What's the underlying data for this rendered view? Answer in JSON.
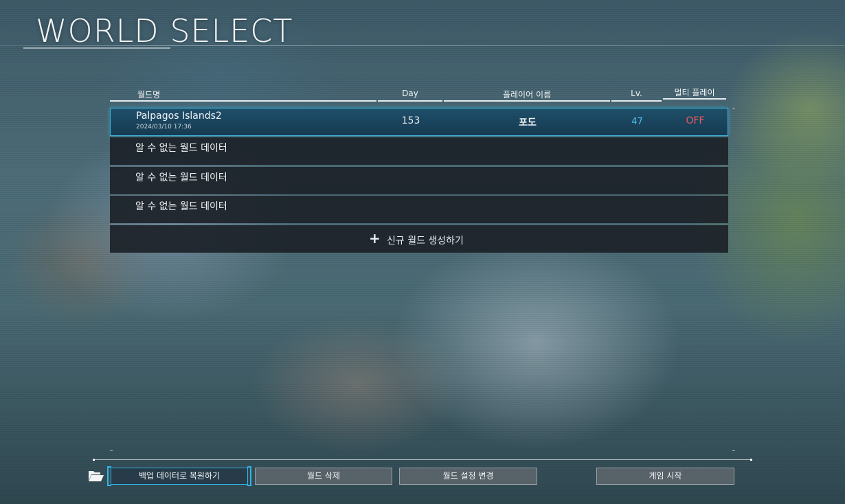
{
  "title": "WORLD SELECT",
  "columns": {
    "world_name": "월드명",
    "day": "Day",
    "player_name": "플레이어 이름",
    "level": "Lv.",
    "multiplayer": "멀티 플레이"
  },
  "worlds": [
    {
      "name": "Palpagos Islands2",
      "date": "2024/03/10 17:36",
      "day": "153",
      "player": "포도",
      "level": "47",
      "multiplayer": "OFF"
    },
    {
      "name": "알 수 없는 월드 데이터"
    },
    {
      "name": "알 수 없는 월드 데이터"
    },
    {
      "name": "알 수 없는 월드 데이터"
    }
  ],
  "new_world_label": "신규 월드 생성하기",
  "new_world_icon": "plus-icon",
  "folder_icon": "folder-open-icon",
  "buttons": {
    "restore_backup": "백업 데이터로 복원하기",
    "delete_world": "월드 삭제",
    "world_settings": "월드 설정 변경",
    "start_game": "게임 시작"
  },
  "colors": {
    "accent": "#3fb2d9",
    "level": "#4fc3ee",
    "multiplayer_off": "#ef5a5a",
    "selected_row": "#1f4e69"
  }
}
